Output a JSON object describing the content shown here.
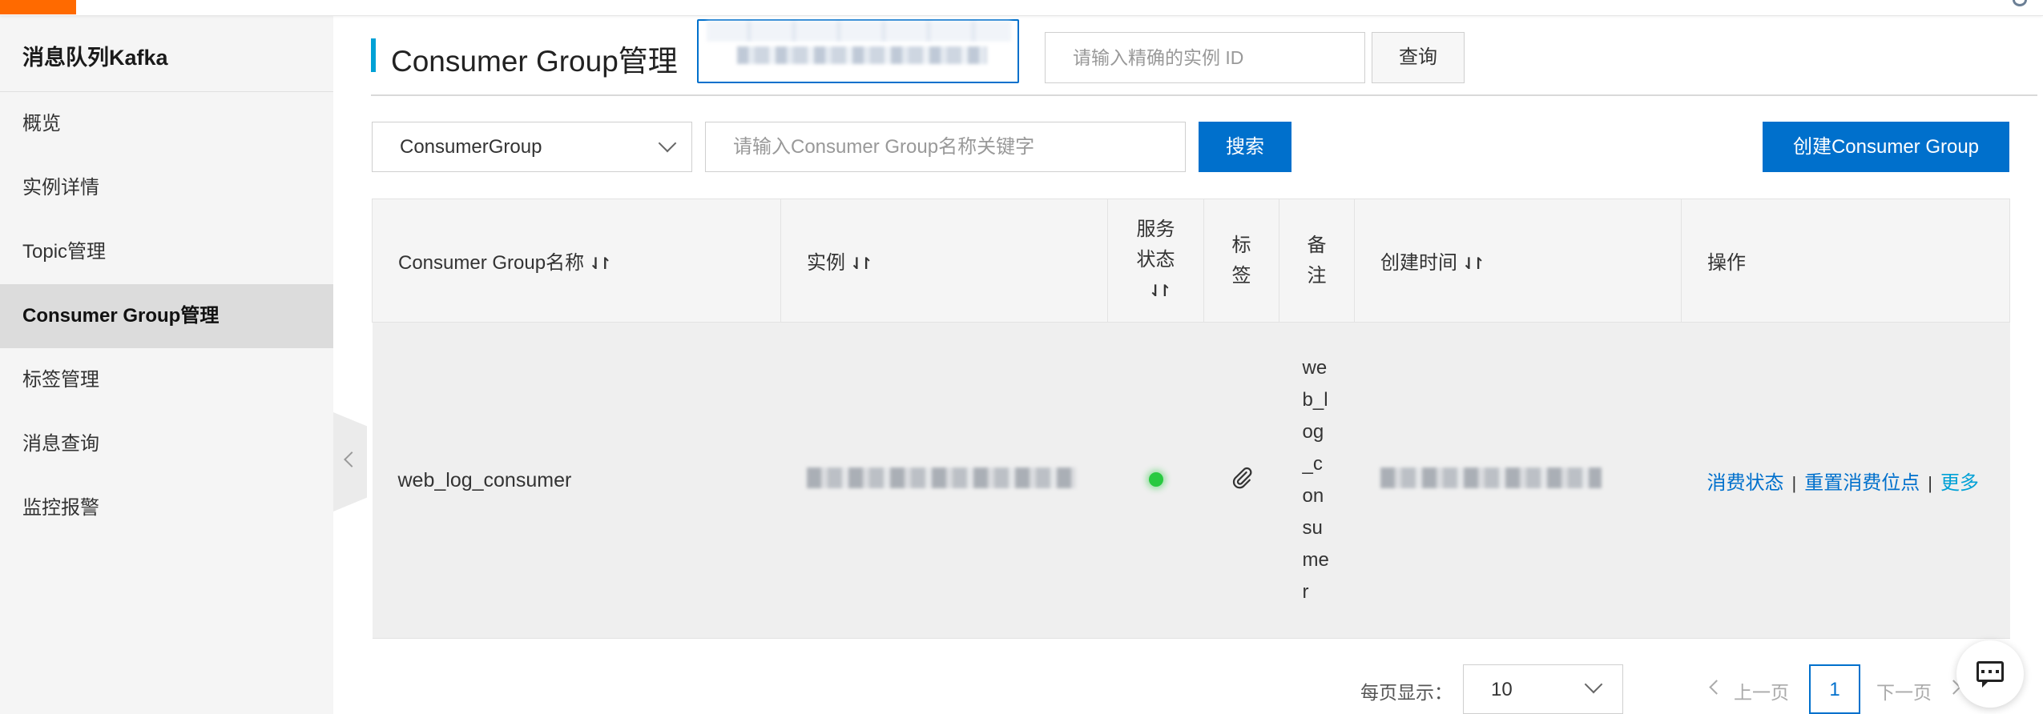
{
  "sidebar": {
    "title": "消息队列Kafka",
    "items": [
      {
        "label": "概览"
      },
      {
        "label": "实例详情"
      },
      {
        "label": "Topic管理"
      },
      {
        "label": "Consumer Group管理"
      },
      {
        "label": "标签管理"
      },
      {
        "label": "消息查询"
      },
      {
        "label": "监控报警"
      }
    ]
  },
  "header": {
    "title": "Consumer Group管理",
    "instance_id_placeholder": "请输入精确的实例 ID",
    "query_label": "查询"
  },
  "filter": {
    "select_value": "ConsumerGroup",
    "keyword_placeholder": "请输入Consumer Group名称关键字",
    "search_label": "搜索",
    "create_label": "创建Consumer Group"
  },
  "table": {
    "columns": {
      "name": "Consumer Group名称",
      "instance": "实例",
      "status_1": "服务",
      "status_2": "状态",
      "tags_1": "标",
      "tags_2": "签",
      "remark_1": "备",
      "remark_2": "注",
      "created": "创建时间",
      "actions": "操作"
    },
    "sort_glyph": "⇃↾",
    "rows": [
      {
        "name": "web_log_consumer",
        "remark": "web_log_consumer",
        "status_color": "#28c940",
        "actions": {
          "status": "消费状态",
          "reset": "重置消费位点",
          "more": "更多"
        }
      }
    ],
    "separator": "|"
  },
  "pagination": {
    "per_page_label": "每页显示：",
    "page_size": "10",
    "prev_label": "上一页",
    "current_page": "1",
    "next_label": "下一页"
  },
  "colors": {
    "primary": "#0070cc",
    "accent_bar": "#00a1d6",
    "brand": "#ff6a00"
  }
}
